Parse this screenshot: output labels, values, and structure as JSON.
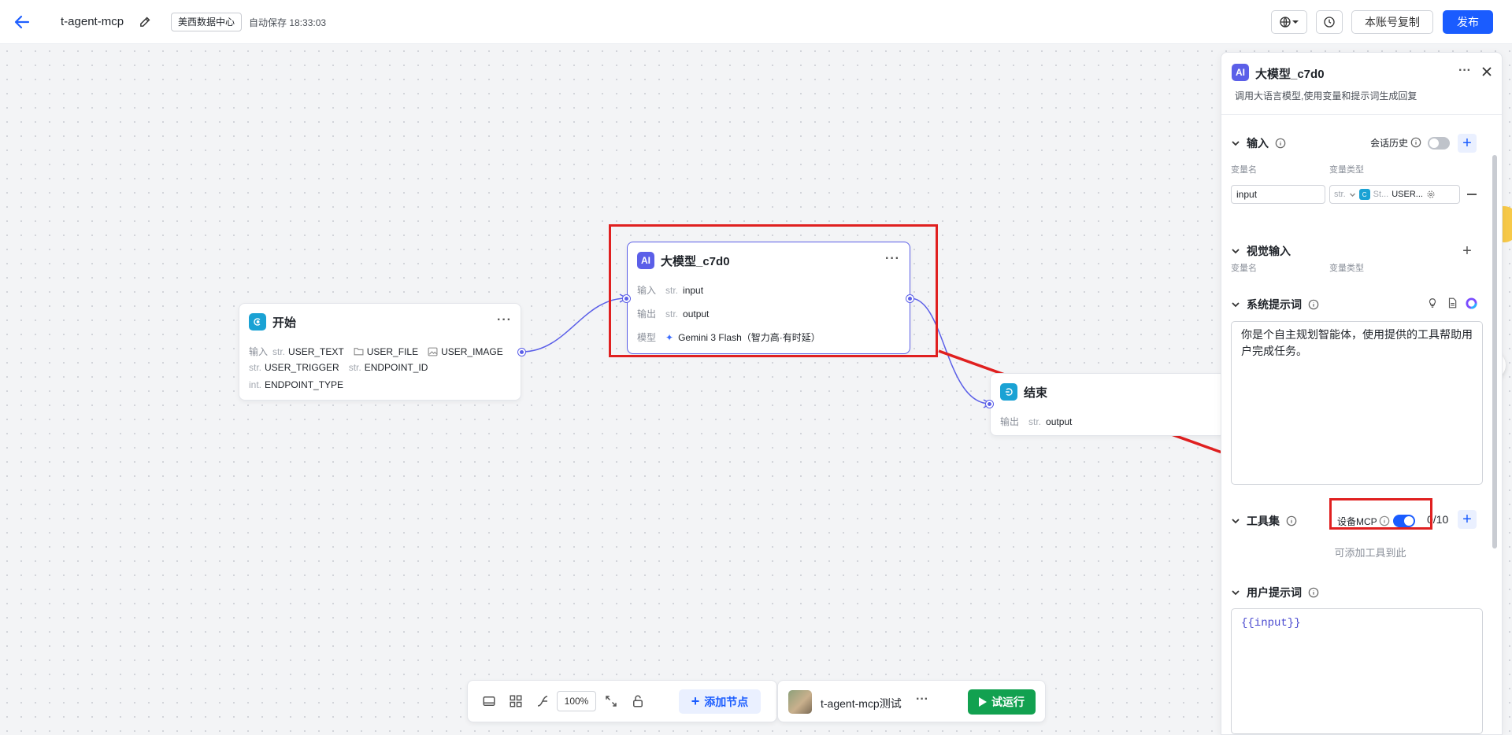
{
  "header": {
    "app_name": "t-agent-mcp",
    "region": "美西数据中心",
    "autosave": "自动保存 18:33:03",
    "copy_label": "本账号复制",
    "publish_label": "发布"
  },
  "canvas": {
    "start_node": {
      "title": "开始",
      "input_label": "输入",
      "inputs": [
        {
          "type": "str.",
          "name": "USER_TEXT"
        },
        {
          "type": "",
          "name": "USER_FILE",
          "icon": "folder-icon"
        },
        {
          "type": "",
          "name": "USER_IMAGE",
          "icon": "image-icon"
        },
        {
          "type": "str.",
          "name": "USER_TRIGGER"
        },
        {
          "type": "str.",
          "name": "ENDPOINT_ID"
        },
        {
          "type": "int.",
          "name": "ENDPOINT_TYPE"
        }
      ]
    },
    "llm_node": {
      "badge": "AI",
      "title": "大模型_c7d0",
      "input_label": "输入",
      "input_type": "str.",
      "input_name": "input",
      "output_label": "输出",
      "output_type": "str.",
      "output_name": "output",
      "model_label": "模型",
      "model_name": "Gemini 3 Flash（智力高·有时延）"
    },
    "end_node": {
      "title": "结束",
      "output_label": "输出",
      "output_type": "str.",
      "output_name": "output"
    }
  },
  "bottom_toolbar": {
    "zoom": "100%",
    "add_node_label": "添加节点"
  },
  "run_bar": {
    "name": "t-agent-mcp测试",
    "run_label": "试运行"
  },
  "panel": {
    "badge": "AI",
    "title": "大模型_c7d0",
    "description": "调用大语言模型,使用变量和提示词生成回复",
    "input_section": {
      "title": "输入",
      "history_label": "会话历史",
      "col_name": "变量名",
      "col_type": "变量类型",
      "var_name": "input",
      "var_type_prefix": "str.",
      "var_type_source": "St...",
      "var_type_value": "USER..."
    },
    "vision_section": {
      "title": "视觉输入",
      "col_name": "变量名",
      "col_type": "变量类型"
    },
    "system_prompt": {
      "title": "系统提示词",
      "text": "你是个自主规划智能体，使用提供的工具帮助用户完成任务。"
    },
    "tools_section": {
      "title": "工具集",
      "mcp_label": "设备MCP",
      "mcp_enabled": true,
      "count": "0/10",
      "empty_text": "可添加工具到此"
    },
    "user_prompt": {
      "title": "用户提示词",
      "text": "{{input}}"
    }
  },
  "colors": {
    "accent": "#1a5cff",
    "node_purple": "#5b5fe8",
    "highlight_red": "#e02020",
    "run_green": "#12a150"
  }
}
